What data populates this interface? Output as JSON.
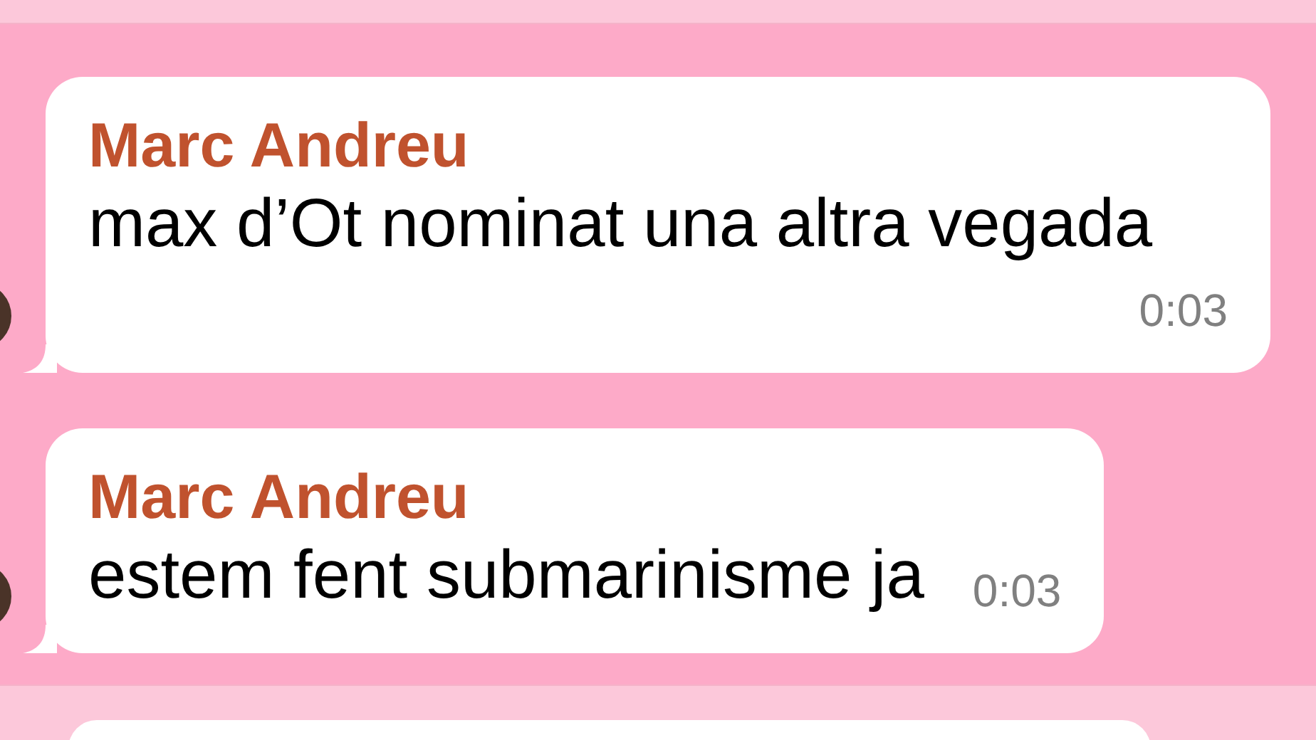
{
  "messages": [
    {
      "sender": "Marc Andreu",
      "text": "max d’Ot nominat una altra vegada",
      "time": "0:03"
    },
    {
      "sender": "Marc Andreu",
      "text": "estem fent submarinisme ja",
      "time": "0:03"
    }
  ]
}
